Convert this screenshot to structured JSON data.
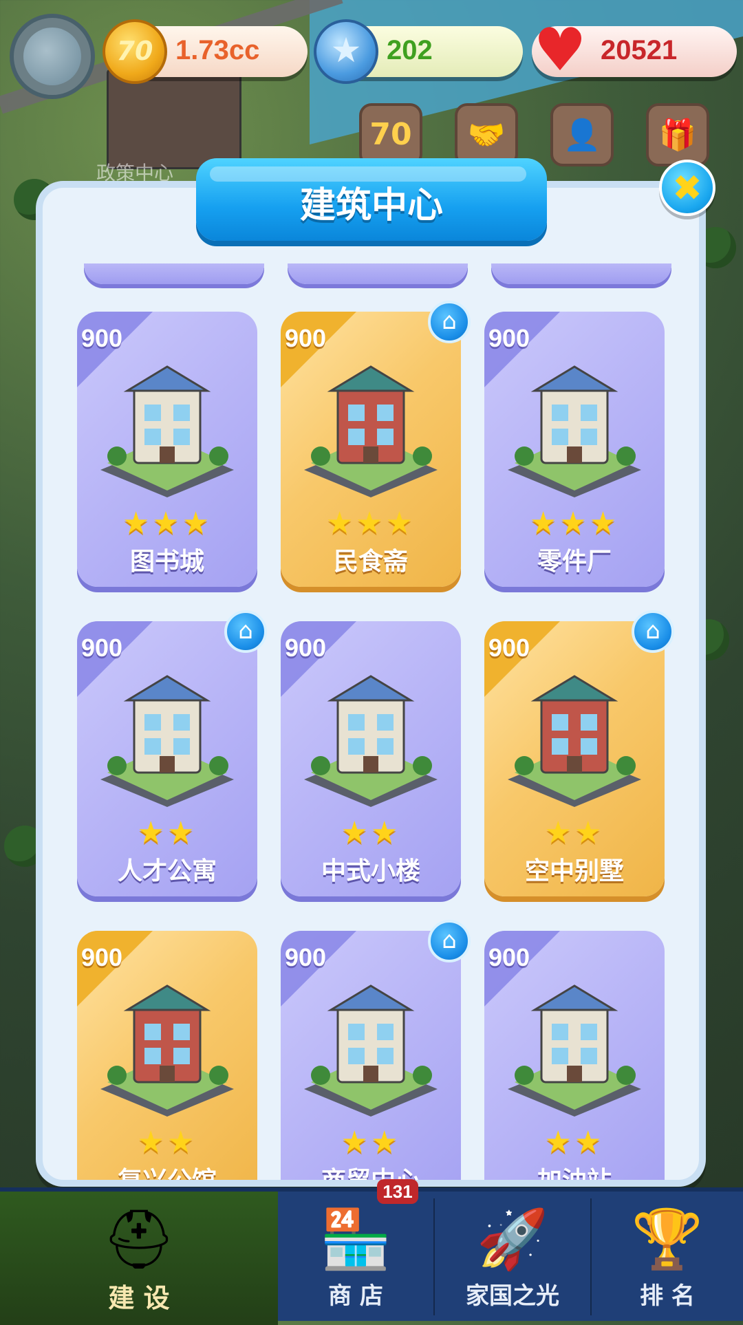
{
  "hud": {
    "coins": "1.73cc",
    "coins_icon_text": "70",
    "stars": "202",
    "hearts": "20521",
    "action_badge": "70"
  },
  "background": {
    "building_label": "政策中心"
  },
  "modal": {
    "title": "建筑中心"
  },
  "buildings": [
    {
      "price": "900",
      "name": "图书城",
      "stars": "★★★",
      "style": "purple",
      "home": false
    },
    {
      "price": "900",
      "name": "民食斋",
      "stars": "★★★",
      "style": "gold",
      "home": true
    },
    {
      "price": "900",
      "name": "零件厂",
      "stars": "★★★",
      "style": "purple",
      "home": false
    },
    {
      "price": "900",
      "name": "人才公寓",
      "stars": "★★",
      "style": "purple",
      "home": true
    },
    {
      "price": "900",
      "name": "中式小楼",
      "stars": "★★",
      "style": "purple",
      "home": false
    },
    {
      "price": "900",
      "name": "空中别墅",
      "stars": "★★",
      "style": "gold",
      "home": true
    },
    {
      "price": "900",
      "name": "复兴公馆",
      "stars": "★★",
      "style": "gold",
      "home": false
    },
    {
      "price": "900",
      "name": "商贸中心",
      "stars": "★★",
      "style": "purple",
      "home": true
    },
    {
      "price": "900",
      "name": "加油站",
      "stars": "★★",
      "style": "purple",
      "home": false
    }
  ],
  "bottom_nav": {
    "build": "建 设",
    "shop": "商 店",
    "shop_badge": "131",
    "country": "家国之光",
    "rank": "排 名"
  }
}
